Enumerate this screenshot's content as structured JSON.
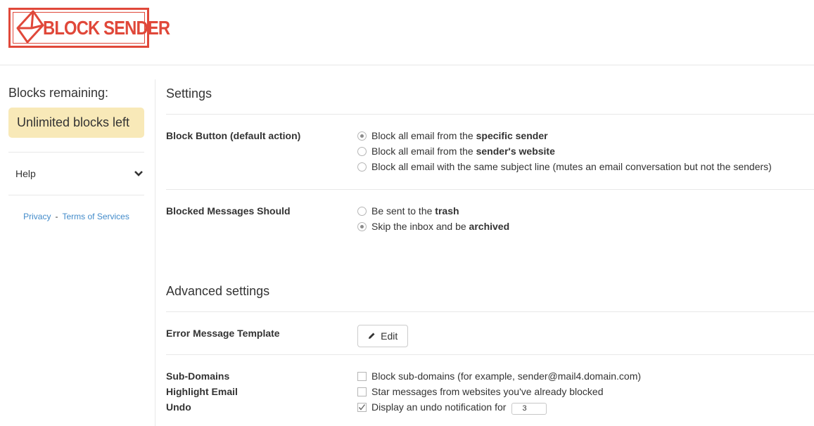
{
  "brand": {
    "logo_text": "BLOCK SENDER",
    "color": "#e0483a"
  },
  "sidebar": {
    "blocks_title": "Blocks remaining:",
    "blocks_badge": "Unlimited blocks left",
    "help_label": "Help",
    "help_icon": "chevron-down-icon",
    "privacy_link": "Privacy",
    "separator": "-",
    "terms_link": "Terms of Services"
  },
  "settings": {
    "title": "Settings",
    "block_button": {
      "label": "Block Button (default action)",
      "options": [
        {
          "prefix": "Block all email from the ",
          "bold": "specific sender",
          "suffix": "",
          "checked": true
        },
        {
          "prefix": "Block all email from the ",
          "bold": "sender's website",
          "suffix": "",
          "checked": false
        },
        {
          "prefix": "Block all email with the same subject line (mutes an email conversation but not the senders)",
          "bold": "",
          "suffix": "",
          "checked": false
        }
      ]
    },
    "blocked_messages": {
      "label": "Blocked Messages Should",
      "options": [
        {
          "prefix": "Be sent to the ",
          "bold": "trash",
          "checked": false
        },
        {
          "prefix": "Skip the inbox and be ",
          "bold": "archived",
          "checked": true
        }
      ]
    }
  },
  "advanced": {
    "title": "Advanced settings",
    "error_template": {
      "label": "Error Message Template",
      "button_label": "Edit",
      "button_icon": "pencil-icon"
    },
    "sub_domains": {
      "label": "Sub-Domains",
      "text": "Block sub-domains (for example, sender@mail4.domain.com)",
      "checked": false
    },
    "highlight_email": {
      "label": "Highlight Email",
      "text": "Star messages from websites you've already blocked",
      "checked": false
    },
    "undo": {
      "label": "Undo",
      "text": "Display an undo notification for",
      "checked": true,
      "value": "3"
    }
  }
}
